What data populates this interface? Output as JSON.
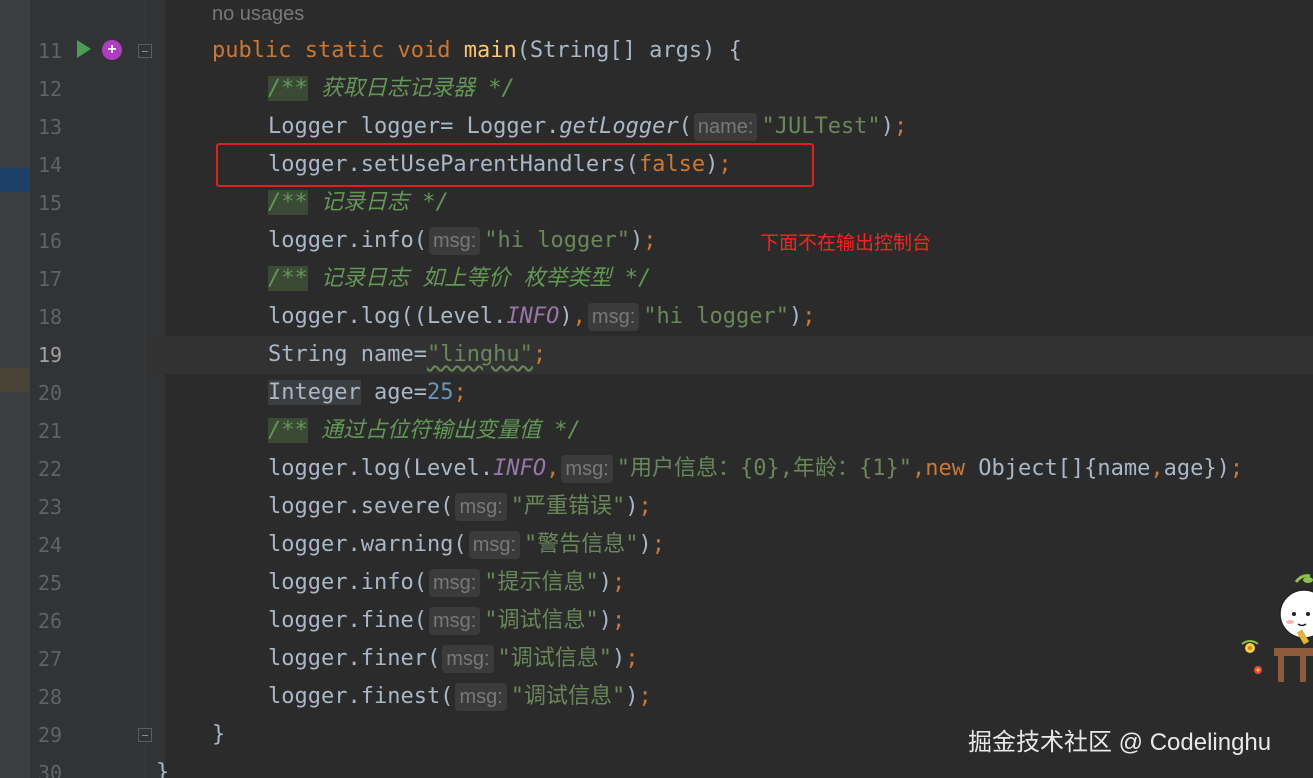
{
  "editor": {
    "usages_hint": "no usages",
    "line_numbers": [
      "11",
      "12",
      "13",
      "14",
      "15",
      "16",
      "17",
      "18",
      "19",
      "20",
      "21",
      "22",
      "23",
      "24",
      "25",
      "26",
      "27",
      "28",
      "29",
      "30"
    ],
    "active_line": "19"
  },
  "code": {
    "l11": {
      "kw1": "public",
      "kw2": "static",
      "kw3": "void",
      "fn": "main",
      "rest": "(String[] args) {"
    },
    "l12": {
      "open": "/**",
      "text": " 获取日志记录器 */"
    },
    "l13": {
      "a": "Logger logger= Logger.",
      "m": "getLogger",
      "p": "(",
      "hint": "name:",
      "s": "\"JULTest\"",
      "e": ")",
      "semi": ";"
    },
    "l14": {
      "a": "logger.setUseParentHandlers(",
      "kw": "false",
      "e": ")",
      "semi": ";"
    },
    "l15": {
      "open": "/**",
      "text": " 记录日志 */"
    },
    "l16": {
      "a": "logger.info(",
      "hint": "msg:",
      "s": "\"hi logger\"",
      "e": ")",
      "semi": ";"
    },
    "l17": {
      "open": "/**",
      "text": " 记录日志 如上等价 枚举类型 */"
    },
    "l18": {
      "a": "logger.log((Level.",
      "c": "INFO",
      "b": ")",
      "comma": ",",
      "hint": "msg:",
      "s": "\"hi logger\"",
      "e": ")",
      "semi": ";"
    },
    "l19": {
      "a": "String name=",
      "s": "\"linghu\"",
      "semi": ";"
    },
    "l20": {
      "t": "Integer",
      "a": " age=",
      "n": "25",
      "semi": ";"
    },
    "l21": {
      "open": "/**",
      "text": " 通过占位符输出变量值 */"
    },
    "l22": {
      "a": "logger.log(Level.",
      "c": "INFO",
      "comma": ",",
      "hint": "msg:",
      "s": "\"用户信息：{0},年龄：{1}\"",
      "comma2": ",",
      "kw": "new",
      "rest": " Object[]{name",
      "comma3": ",",
      "rest2": "age})",
      "semi": ";"
    },
    "l23": {
      "a": "logger.severe(",
      "hint": "msg:",
      "s": "\"严重错误\"",
      "e": ")",
      "semi": ";"
    },
    "l24": {
      "a": "logger.warning(",
      "hint": "msg:",
      "s": "\"警告信息\"",
      "e": ")",
      "semi": ";"
    },
    "l25": {
      "a": "logger.info(",
      "hint": "msg:",
      "s": "\"提示信息\"",
      "e": ")",
      "semi": ";"
    },
    "l26": {
      "a": "logger.fine(",
      "hint": "msg:",
      "s": "\"调试信息\"",
      "e": ")",
      "semi": ";"
    },
    "l27": {
      "a": "logger.finer(",
      "hint": "msg:",
      "s": "\"调试信息\"",
      "e": ")",
      "semi": ";"
    },
    "l28": {
      "a": "logger.finest(",
      "hint": "msg:",
      "s": "\"调试信息\"",
      "e": ")",
      "semi": ";"
    },
    "l29": {
      "a": "}"
    },
    "l30": {
      "a": "}"
    }
  },
  "annotation": "下面不在输出控制台",
  "watermark": "掘金技术社区 @ Codelinghu",
  "colors": {
    "annotation_box": "#e0201f",
    "annotation_text": "#ff2020",
    "keyword": "#cc7832",
    "string": "#6a8759",
    "number": "#6897bb",
    "comment": "#629755"
  },
  "icons": {
    "run": "run-icon",
    "plugin": "plugin-icon",
    "fold": "fold-icon",
    "mascot": "mascot-sticker"
  }
}
